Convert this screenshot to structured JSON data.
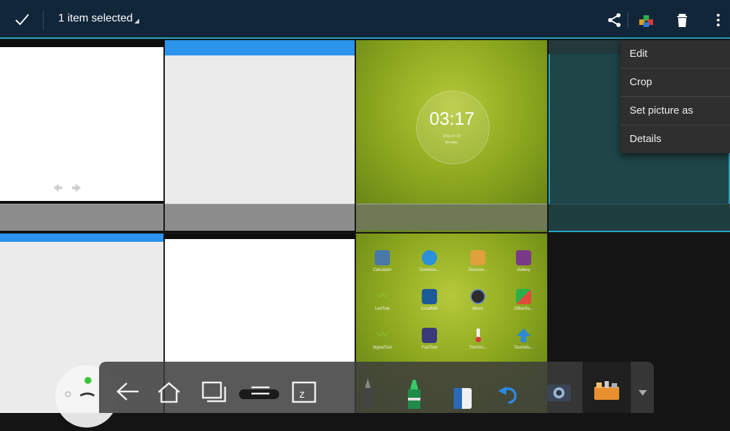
{
  "action_bar": {
    "selection_text": "1 item selected",
    "icons": [
      "check-icon",
      "share-icon",
      "app-logo-icon",
      "trash-icon",
      "overflow-menu-icon"
    ]
  },
  "menu": {
    "items": [
      {
        "label": "Edit"
      },
      {
        "label": "Crop"
      },
      {
        "label": "Set picture as"
      },
      {
        "label": "Details"
      }
    ]
  },
  "thumbnails": {
    "clock": {
      "time": "03:17",
      "date": "2016-07-18",
      "day": "Monday"
    },
    "launcher": {
      "apps": [
        {
          "label": "Calculator",
          "color": "#4a78a8"
        },
        {
          "label": "Downloa...",
          "color": "#2a90d8"
        },
        {
          "label": "Docume...",
          "color": "#e0a03a"
        },
        {
          "label": "Gallery",
          "color": "#7a3a8a"
        },
        {
          "label": "LedTool",
          "color": "#8ec63a"
        },
        {
          "label": "LocalMM",
          "color": "#1d5a9a"
        },
        {
          "label": "Music",
          "color": "#2c2c2c"
        },
        {
          "label": "OfficeSu...",
          "color": "#e04a3a"
        },
        {
          "label": "SignalTool",
          "color": "#8ec63a"
        },
        {
          "label": "FastTool",
          "color": "#3a3a7a"
        },
        {
          "label": "Thermo...",
          "color": "#d87a3a"
        },
        {
          "label": "Touchdo...",
          "color": "#2a8ad8"
        }
      ]
    }
  },
  "colors": {
    "actionbar_bg": "#12263a",
    "accent": "#27a6c9",
    "menu_bg": "#2f2f2f"
  }
}
